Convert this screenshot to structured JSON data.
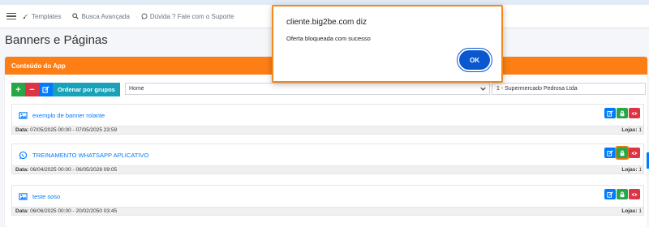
{
  "navbar": {
    "templates": "Templates",
    "search": "Busca Avançada",
    "support": "Dúvida ? Fale com o Suporte"
  },
  "page_title": "Banners e Páginas",
  "section_header": "Conteúdo do App",
  "toolbar": {
    "add": "+",
    "remove": "−",
    "group_label": "Ordenar por grupos"
  },
  "filters": {
    "page_select": "Home",
    "store_select": "1 - Supermercado Pedrosa Ltda"
  },
  "items": [
    {
      "title": "exemplo de banner rolante",
      "date_label": "Data:",
      "date_value": "07/05/2025 00:00 - 07/05/2025 23:59",
      "stores_label": "Lojas:",
      "stores_value": "1"
    },
    {
      "title": "TREINAMENTO WHATSAPP APLICATIVO",
      "date_label": "Data:",
      "date_value": "06/04/2025 00:00 - 06/05/2028 09:05",
      "stores_label": "Lojas:",
      "stores_value": "1"
    },
    {
      "title": "teste soso",
      "date_label": "Data:",
      "date_value": "06/06/2025 00:00 - 20/02/2050 03:45",
      "stores_label": "Lojas:",
      "stores_value": "1"
    }
  ],
  "dialog": {
    "title": "cliente.big2be.com diz",
    "message": "Oferta bloqueada com sucesso",
    "ok": "OK"
  },
  "colors": {
    "accent": "#fd7e14",
    "primary": "#007bff",
    "success": "#28a745",
    "danger": "#dc3545",
    "dialog_border": "#f28a1e"
  }
}
